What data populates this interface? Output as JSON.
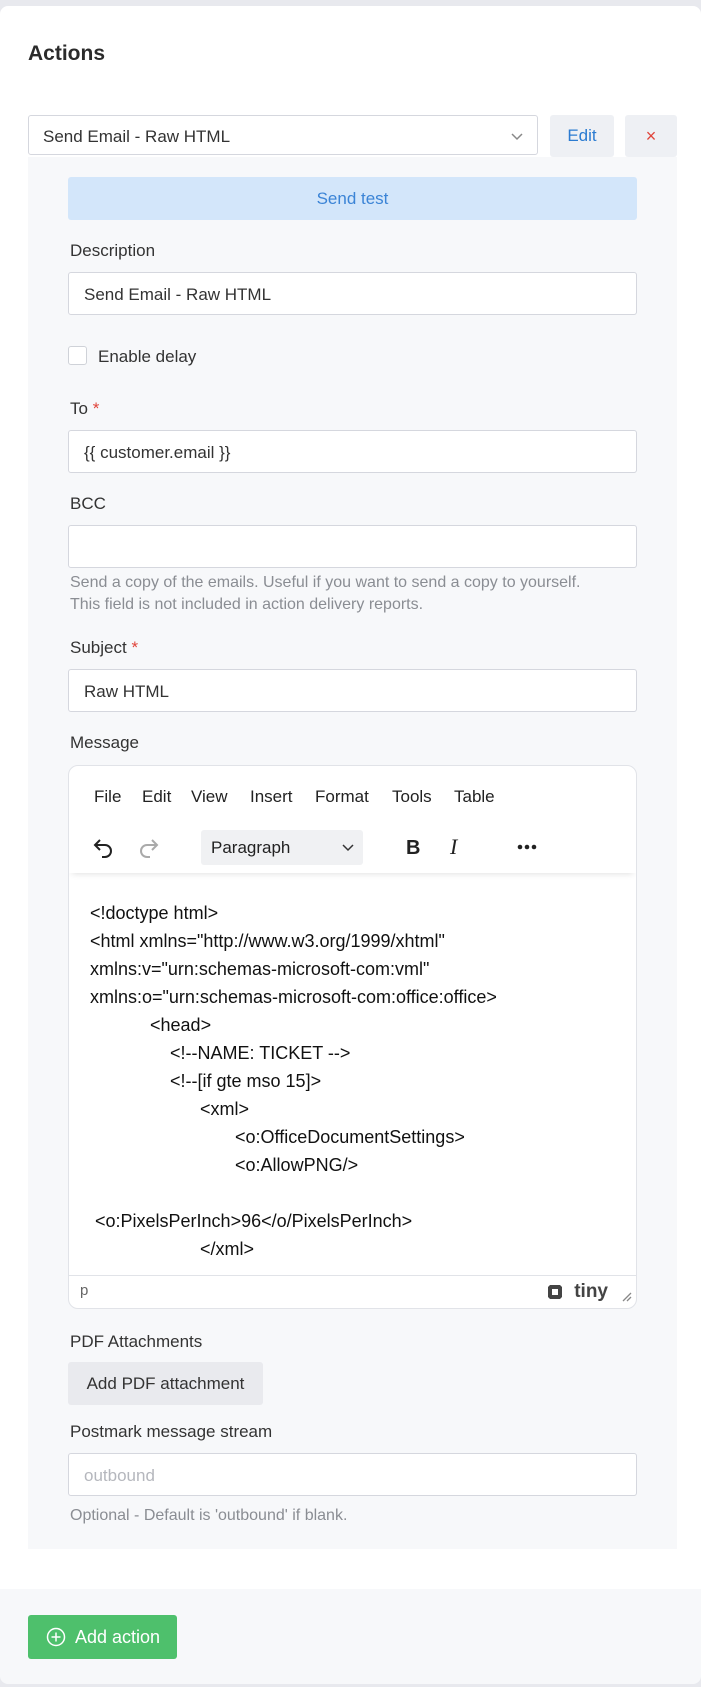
{
  "section": {
    "title": "Actions"
  },
  "action_row": {
    "selected_action": "Send Email - Raw HTML",
    "edit_label": "Edit",
    "remove_label": "×"
  },
  "form": {
    "send_test_label": "Send test",
    "description": {
      "label": "Description",
      "value": "Send Email - Raw HTML"
    },
    "enable_delay": {
      "label": "Enable delay",
      "checked": false
    },
    "to": {
      "label": "To",
      "required": "*",
      "value": "{{ customer.email }}"
    },
    "bcc": {
      "label": "BCC",
      "value": "",
      "help_line1": "Send a copy of the emails. Useful if you want to send a copy to yourself.",
      "help_line2": "This field is not included in action delivery reports."
    },
    "subject": {
      "label": "Subject",
      "required": "*",
      "value": "Raw HTML"
    },
    "message": {
      "label": "Message",
      "menu": [
        "File",
        "Edit",
        "View",
        "Insert",
        "Format",
        "Tools",
        "Table"
      ],
      "block_format": "Paragraph",
      "code_lines": [
        "<!doctype html>",
        "<html xmlns=\"http://www.w3.org/1999/xhtml\"",
        "xmlns:v=\"urn:schemas-microsoft-com:vml\"",
        "xmlns:o=\"urn:schemas-microsoft-com:office:office>",
        "            <head>",
        "                <!--NAME: TICKET -->",
        "                <!--[if gte mso 15]>",
        "                      <xml>",
        "                             <o:OfficeDocumentSettings>",
        "                             <o:AllowPNG/>",
        "",
        " <o:PixelsPerInch>96</o/PixelsPerInch>",
        "                      </xml>"
      ],
      "status_path": "p",
      "brand": "tiny"
    },
    "pdf": {
      "label": "PDF Attachments",
      "button_label": "Add PDF attachment"
    },
    "postmark": {
      "label": "Postmark message stream",
      "placeholder": "outbound",
      "help": "Optional - Default is 'outbound' if blank."
    }
  },
  "footer": {
    "add_action_label": "Add action"
  },
  "colors": {
    "accent_blue": "#2b7bd1",
    "danger_red": "#e0443a",
    "success_green": "#4ec06c"
  }
}
